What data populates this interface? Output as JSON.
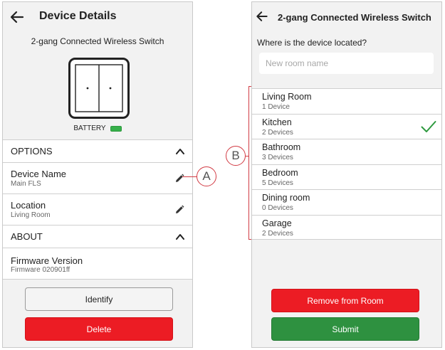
{
  "left_screen": {
    "title": "Device Details",
    "device_name": "2-gang Connected Wireless Switch",
    "battery_label": "BATTERY",
    "options_header": "OPTIONS",
    "rows": [
      {
        "title": "Device Name",
        "subtitle": "Main FLS"
      },
      {
        "title": "Location",
        "subtitle": "Living Room"
      }
    ],
    "about_header": "ABOUT",
    "firmware": {
      "title": "Firmware Version",
      "subtitle": "Firmware 020901ff"
    },
    "identify_label": "Identify",
    "delete_label": "Delete"
  },
  "right_screen": {
    "title": "2-gang Connected Wireless Switch",
    "question": "Where is the device located?",
    "room_input_placeholder": "New room name",
    "rooms": [
      {
        "name": "Living Room",
        "count": "1 Device",
        "selected": false
      },
      {
        "name": "Kitchen",
        "count": "2 Devices",
        "selected": true
      },
      {
        "name": "Bathroom",
        "count": "3 Devices",
        "selected": false
      },
      {
        "name": "Bedroom",
        "count": "5 Devices",
        "selected": false
      },
      {
        "name": "Dining room",
        "count": "0 Devices",
        "selected": false
      },
      {
        "name": "Garage",
        "count": "2 Devices",
        "selected": false
      }
    ],
    "remove_label": "Remove from Room",
    "submit_label": "Submit"
  },
  "callouts": {
    "a": "A",
    "b": "B"
  },
  "colors": {
    "accent_red": "#ec1c24",
    "accent_green": "#2e9140",
    "check_green": "#2e9a3f",
    "callout_red": "#d23b44",
    "battery_green": "#36b04a"
  },
  "icons": [
    "back-arrow-icon",
    "chevron-up-icon",
    "pencil-icon",
    "check-icon",
    "battery-icon",
    "switch-device-icon"
  ]
}
